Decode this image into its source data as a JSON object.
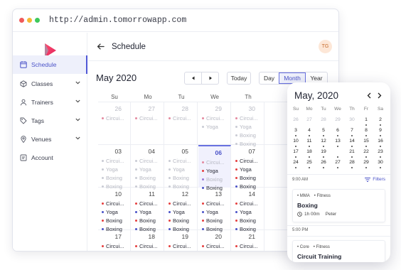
{
  "browser": {
    "url": "http://admin.tomorrowapp.com",
    "traffic_lights": [
      "#f05a5a",
      "#f5b836",
      "#3ec95b"
    ]
  },
  "sidebar": {
    "items": [
      {
        "label": "Schedule",
        "icon": "schedule-icon",
        "active": true,
        "expandable": false
      },
      {
        "label": "Classes",
        "icon": "box-icon",
        "active": false,
        "expandable": true
      },
      {
        "label": "Trainers",
        "icon": "person-icon",
        "active": false,
        "expandable": true
      },
      {
        "label": "Tags",
        "icon": "tag-icon",
        "active": false,
        "expandable": true
      },
      {
        "label": "Venues",
        "icon": "pin-icon",
        "active": false,
        "expandable": true
      },
      {
        "label": "Account",
        "icon": "account-icon",
        "active": false,
        "expandable": false
      }
    ]
  },
  "header": {
    "title": "Schedule",
    "avatar": "TG"
  },
  "calendar": {
    "month_label": "May 2020",
    "today_label": "Today",
    "views": [
      "Day",
      "Month",
      "Year"
    ],
    "active_view": "Month",
    "day_headers": [
      "Su",
      "Mo",
      "Tu",
      "We",
      "Th"
    ],
    "colors": {
      "red": "#e53e3e",
      "blue": "#4a52c8",
      "pink": "#e48aa0",
      "purple": "#9a7bd8",
      "faded": "#c9cbd4"
    },
    "weeks": [
      {
        "days": [
          {
            "num": "26",
            "faded": true,
            "events": [
              {
                "label": "Circui...",
                "color": "pink",
                "faded": true
              }
            ]
          },
          {
            "num": "27",
            "faded": true,
            "events": [
              {
                "label": "Circui...",
                "color": "pink",
                "faded": true
              }
            ]
          },
          {
            "num": "28",
            "faded": true,
            "events": [
              {
                "label": "Circui...",
                "color": "pink",
                "faded": true
              }
            ]
          },
          {
            "num": "29",
            "faded": true,
            "events": [
              {
                "label": "Circui...",
                "color": "pink",
                "faded": true
              },
              {
                "label": "Yoga",
                "color": "faded",
                "faded": true
              }
            ]
          },
          {
            "num": "30",
            "faded": true,
            "events": [
              {
                "label": "Circui...",
                "color": "pink",
                "faded": true
              },
              {
                "label": "Yoga",
                "color": "faded",
                "faded": true
              },
              {
                "label": "Boxing",
                "color": "faded",
                "faded": true
              },
              {
                "label": "Boxing",
                "color": "faded",
                "faded": true
              }
            ]
          }
        ]
      },
      {
        "days": [
          {
            "num": "03",
            "faded": false,
            "events": [
              {
                "label": "Circui...",
                "color": "faded",
                "faded": true
              },
              {
                "label": "Yoga",
                "color": "faded",
                "faded": true
              },
              {
                "label": "Boxing",
                "color": "faded",
                "faded": true
              },
              {
                "label": "Boxing",
                "color": "faded",
                "faded": true
              }
            ]
          },
          {
            "num": "04",
            "faded": false,
            "events": [
              {
                "label": "Circui...",
                "color": "faded",
                "faded": true
              },
              {
                "label": "Yoga",
                "color": "faded",
                "faded": true
              },
              {
                "label": "Boxing",
                "color": "faded",
                "faded": true
              },
              {
                "label": "Boxing",
                "color": "faded",
                "faded": true
              }
            ]
          },
          {
            "num": "05",
            "faded": false,
            "events": [
              {
                "label": "Circui...",
                "color": "faded",
                "faded": true
              },
              {
                "label": "Yoga",
                "color": "faded",
                "faded": true
              },
              {
                "label": "Boxing",
                "color": "faded",
                "faded": true
              },
              {
                "label": "Boxing",
                "color": "faded",
                "faded": true
              }
            ]
          },
          {
            "num": "06",
            "faded": false,
            "today": true,
            "events": [
              {
                "label": "Circui...",
                "color": "pink",
                "faded": true
              },
              {
                "label": "Yoga",
                "color": "red",
                "faded": false
              },
              {
                "label": "Boxing",
                "color": "purple",
                "faded": true
              },
              {
                "label": "Boxing",
                "color": "blue",
                "faded": false
              }
            ]
          },
          {
            "num": "07",
            "faded": false,
            "events": [
              {
                "label": "Circui...",
                "color": "red",
                "faded": false
              },
              {
                "label": "Yoga",
                "color": "red",
                "faded": false
              },
              {
                "label": "Boxing",
                "color": "red",
                "faded": false
              },
              {
                "label": "Boxing",
                "color": "blue",
                "faded": false
              }
            ]
          }
        ]
      },
      {
        "days": [
          {
            "num": "10",
            "faded": false,
            "events": [
              {
                "label": "Circui...",
                "color": "red",
                "faded": false
              },
              {
                "label": "Yoga",
                "color": "blue",
                "faded": false
              },
              {
                "label": "Boxing",
                "color": "red",
                "faded": false
              },
              {
                "label": "Boxing",
                "color": "blue",
                "faded": false
              }
            ]
          },
          {
            "num": "11",
            "faded": false,
            "events": [
              {
                "label": "Circui...",
                "color": "red",
                "faded": false
              },
              {
                "label": "Yoga",
                "color": "blue",
                "faded": false
              },
              {
                "label": "Boxing",
                "color": "red",
                "faded": false
              },
              {
                "label": "Boxing",
                "color": "blue",
                "faded": false
              }
            ]
          },
          {
            "num": "12",
            "faded": false,
            "events": [
              {
                "label": "Circui...",
                "color": "red",
                "faded": false
              },
              {
                "label": "Yoga",
                "color": "blue",
                "faded": false
              },
              {
                "label": "Boxing",
                "color": "red",
                "faded": false
              },
              {
                "label": "Boxing",
                "color": "blue",
                "faded": false
              }
            ]
          },
          {
            "num": "13",
            "faded": false,
            "events": [
              {
                "label": "Circui...",
                "color": "red",
                "faded": false
              },
              {
                "label": "Yoga",
                "color": "blue",
                "faded": false
              },
              {
                "label": "Boxing",
                "color": "red",
                "faded": false
              },
              {
                "label": "Boxing",
                "color": "blue",
                "faded": false
              }
            ]
          },
          {
            "num": "14",
            "faded": false,
            "events": [
              {
                "label": "Circui...",
                "color": "red",
                "faded": false
              },
              {
                "label": "Yoga",
                "color": "blue",
                "faded": false
              },
              {
                "label": "Boxing",
                "color": "red",
                "faded": false
              },
              {
                "label": "Boxing",
                "color": "blue",
                "faded": false
              }
            ]
          }
        ]
      },
      {
        "days": [
          {
            "num": "17",
            "faded": false,
            "events": [
              {
                "label": "Circui...",
                "color": "red",
                "faded": false
              },
              {
                "label": "Yoga",
                "color": "blue",
                "faded": false
              }
            ]
          },
          {
            "num": "18",
            "faded": false,
            "events": [
              {
                "label": "Circui...",
                "color": "red",
                "faded": false
              },
              {
                "label": "Yoga",
                "color": "blue",
                "faded": false
              }
            ]
          },
          {
            "num": "19",
            "faded": false,
            "events": [
              {
                "label": "Circui...",
                "color": "red",
                "faded": false
              },
              {
                "label": "Yoga",
                "color": "blue",
                "faded": false
              }
            ]
          },
          {
            "num": "20",
            "faded": false,
            "events": [
              {
                "label": "Circui...",
                "color": "red",
                "faded": false
              },
              {
                "label": "Yoga",
                "color": "blue",
                "faded": false
              }
            ]
          },
          {
            "num": "21",
            "faded": false,
            "events": [
              {
                "label": "Circui...",
                "color": "red",
                "faded": false
              },
              {
                "label": "Yoga",
                "color": "blue",
                "faded": false
              }
            ]
          }
        ]
      }
    ]
  },
  "mobile": {
    "month_label": "May, 2020",
    "day_headers": [
      "Su",
      "Mo",
      "Tu",
      "We",
      "Th",
      "Fr",
      "Sa"
    ],
    "selected_day": "20",
    "weeks": [
      [
        {
          "n": "26",
          "f": true
        },
        {
          "n": "27",
          "f": true
        },
        {
          "n": "28",
          "f": true
        },
        {
          "n": "29",
          "f": true
        },
        {
          "n": "30",
          "f": true
        },
        {
          "n": "1",
          "f": false
        },
        {
          "n": "2",
          "f": false
        }
      ],
      [
        {
          "n": "3",
          "f": false
        },
        {
          "n": "4",
          "f": false
        },
        {
          "n": "5",
          "f": false
        },
        {
          "n": "6",
          "f": false
        },
        {
          "n": "7",
          "f": false
        },
        {
          "n": "8",
          "f": false
        },
        {
          "n": "9",
          "f": false
        }
      ],
      [
        {
          "n": "10",
          "f": false
        },
        {
          "n": "11",
          "f": false
        },
        {
          "n": "12",
          "f": false
        },
        {
          "n": "13",
          "f": false
        },
        {
          "n": "14",
          "f": false
        },
        {
          "n": "15",
          "f": false
        },
        {
          "n": "16",
          "f": false
        }
      ],
      [
        {
          "n": "17",
          "f": false
        },
        {
          "n": "18",
          "f": false
        },
        {
          "n": "19",
          "f": false
        },
        {
          "n": "20",
          "f": false
        },
        {
          "n": "21",
          "f": false
        },
        {
          "n": "22",
          "f": false
        },
        {
          "n": "23",
          "f": false
        }
      ],
      [
        {
          "n": "24",
          "f": false
        },
        {
          "n": "25",
          "f": false
        },
        {
          "n": "26",
          "f": false
        },
        {
          "n": "27",
          "f": false
        },
        {
          "n": "28",
          "f": false
        },
        {
          "n": "29",
          "f": false
        },
        {
          "n": "30",
          "f": false
        }
      ]
    ],
    "time1": "9:00 AM",
    "filters_label": "Filters",
    "time2": "5:00 PM",
    "card1": {
      "tag1": "MMA",
      "tag2": "Fitness",
      "title": "Boxing",
      "duration": "1h 00m",
      "trainer": "Peter"
    },
    "card2": {
      "tag1": "Core",
      "tag2": "Fitness",
      "title": "Circuit Training"
    }
  }
}
